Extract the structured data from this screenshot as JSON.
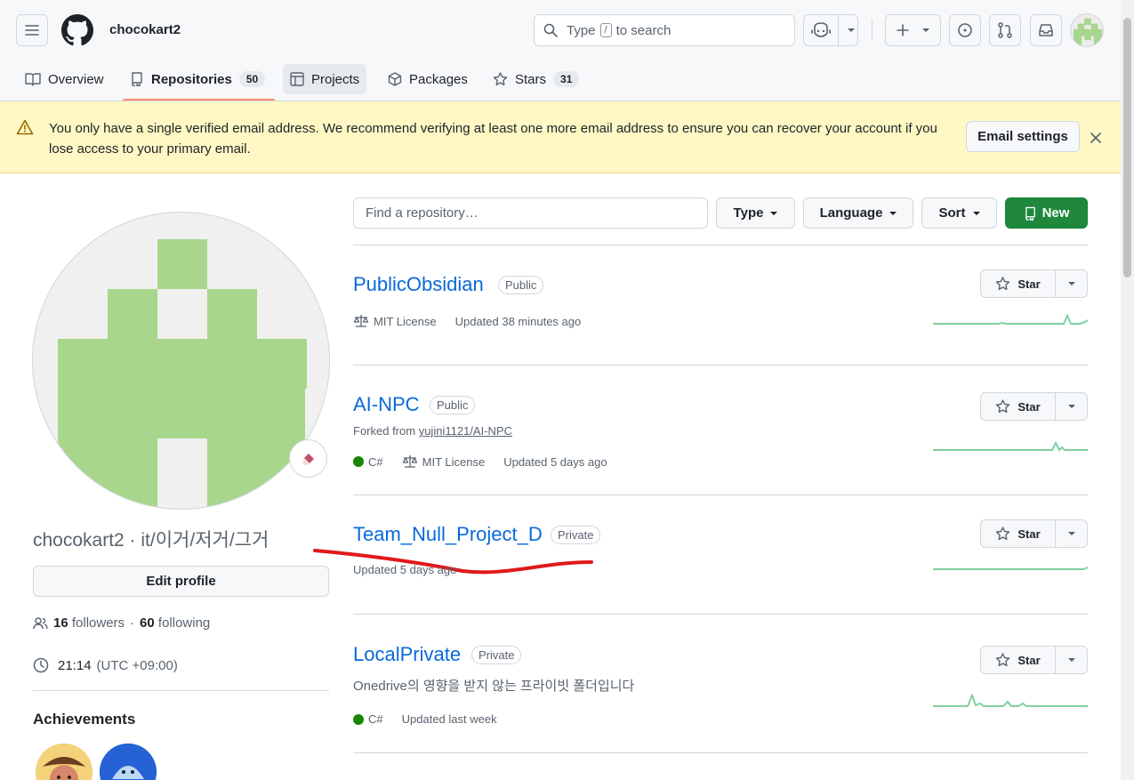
{
  "header": {
    "username": "chocokart2",
    "search": {
      "prefix": "Type",
      "key": "/",
      "suffix": "to search"
    }
  },
  "tabs": [
    {
      "label": "Overview"
    },
    {
      "label": "Repositories",
      "count": "50"
    },
    {
      "label": "Projects"
    },
    {
      "label": "Packages"
    },
    {
      "label": "Stars",
      "count": "31"
    }
  ],
  "banner": {
    "message": "You only have a single verified email address. We recommend verifying at least one more email address to ensure you can recover your account if you lose access to your primary email.",
    "button": "Email settings"
  },
  "profile": {
    "name": "chocokart2 · it/이거/저거/그거",
    "edit_button": "Edit profile",
    "followers_count": "16",
    "followers_label": "followers",
    "separator": "·",
    "following_count": "60",
    "following_label": "following",
    "time": "21:14",
    "timezone": "(UTC +09:00)",
    "achievements_title": "Achievements"
  },
  "filters": {
    "find_placeholder": "Find a repository…",
    "type": "Type",
    "language": "Language",
    "sort": "Sort",
    "new": "New"
  },
  "repos": [
    {
      "name": "PublicObsidian",
      "visibility": "Public",
      "license": "MIT License",
      "updated": "Updated 38 minutes ago",
      "star": "Star"
    },
    {
      "name": "AI-NPC",
      "visibility": "Public",
      "forked_prefix": "Forked from",
      "forked_from": "yujini1121/AI-NPC",
      "language": "C#",
      "license": "MIT License",
      "updated": "Updated 5 days ago",
      "star": "Star"
    },
    {
      "name": "Team_Null_Project_D",
      "visibility": "Private",
      "updated": "Updated 5 days ago",
      "star": "Star"
    },
    {
      "name": "LocalPrivate",
      "visibility": "Private",
      "description": "Onedrive의 영향을 받지 않는 프라이빗 폴더입니다",
      "language": "C#",
      "updated": "Updated last week",
      "star": "Star"
    }
  ],
  "colors": {
    "accent": "#0969da",
    "new_button": "#1f883d",
    "banner": "#fff8c5",
    "csharp": "#178600",
    "annotation": "#e0191b"
  }
}
